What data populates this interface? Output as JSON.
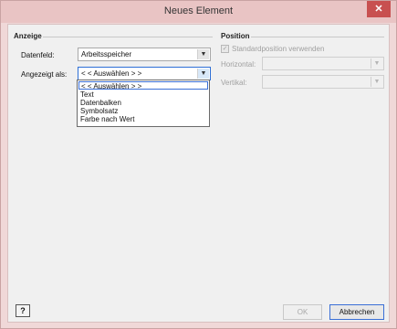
{
  "window": {
    "title": "Neues Element",
    "close_glyph": "✕"
  },
  "anzeige": {
    "group_label": "Anzeige",
    "datenfeld_label": "Datenfeld:",
    "datenfeld_value": "Arbeitsspeicher",
    "angezeigt_label": "Angezeigt als:",
    "angezeigt_value": "< < Auswählen > >",
    "dropdown_items": [
      "< < Auswählen > >",
      "Text",
      "Datenbalken",
      "Symbolsatz",
      "Farbe nach Wert"
    ]
  },
  "position": {
    "group_label": "Position",
    "standard_label": "Standardposition verwenden",
    "standard_checked": true,
    "horizontal_label": "Horizontal:",
    "vertikal_label": "Vertikal:"
  },
  "footer": {
    "help_glyph": "?",
    "ok_label": "OK",
    "cancel_label": "Abbrechen"
  },
  "icons": {
    "dropdown_arrow": "chevron-down-icon",
    "checkmark": "check-icon",
    "help": "help-icon",
    "close": "close-icon"
  }
}
